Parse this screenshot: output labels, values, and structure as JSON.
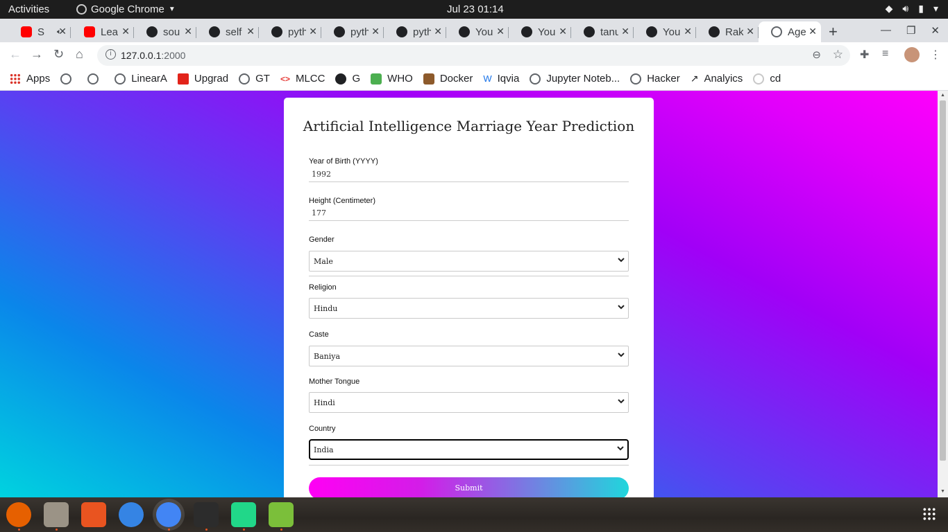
{
  "topbar": {
    "activities": "Activities",
    "app_name": "Google Chrome",
    "clock": "Jul 23  01:14",
    "tray_icons": [
      "wifi-icon",
      "volume-icon",
      "battery-icon",
      "power-menu-icon"
    ]
  },
  "tabs": [
    {
      "title": "S",
      "favicon": "youtube-icon",
      "audio": true
    },
    {
      "title": "Lear",
      "favicon": "youtube-icon"
    },
    {
      "title": "sou",
      "favicon": "github-icon"
    },
    {
      "title": "self",
      "favicon": "github-icon"
    },
    {
      "title": "pyth",
      "favicon": "github-icon"
    },
    {
      "title": "pyth",
      "favicon": "github-icon"
    },
    {
      "title": "pyth",
      "favicon": "github-icon"
    },
    {
      "title": "You",
      "favicon": "github-icon"
    },
    {
      "title": "You",
      "favicon": "github-icon"
    },
    {
      "title": "tanu",
      "favicon": "github-icon"
    },
    {
      "title": "You",
      "favicon": "github-icon"
    },
    {
      "title": "Rak",
      "favicon": "github-icon"
    },
    {
      "title": "Age",
      "favicon": "globe-icon",
      "active": true
    }
  ],
  "toolbar": {
    "url_host": "127.0.0.1",
    "url_port": ":2000"
  },
  "bookmarks": [
    {
      "label": "Apps",
      "icon": "apps-grid-icon"
    },
    {
      "label": "",
      "icon": "globe-icon"
    },
    {
      "label": "",
      "icon": "globe-icon"
    },
    {
      "label": "LinearA",
      "icon": "globe-icon"
    },
    {
      "label": "Upgrad",
      "icon": "upgrad-icon"
    },
    {
      "label": "GT",
      "icon": "globe-icon"
    },
    {
      "label": "MLCC",
      "icon": "mlcc-icon"
    },
    {
      "label": "G",
      "icon": "github-icon"
    },
    {
      "label": "WHO",
      "icon": "who-icon"
    },
    {
      "label": "Docker",
      "icon": "docker-icon"
    },
    {
      "label": "Iqvia",
      "icon": "iqvia-icon"
    },
    {
      "label": "Jupyter Noteb...",
      "icon": "globe-icon"
    },
    {
      "label": "Hacker",
      "icon": "globe-icon"
    },
    {
      "label": "Analyics",
      "icon": "analytics-icon"
    },
    {
      "label": "cd",
      "icon": "cd-icon"
    }
  ],
  "form": {
    "title": "Artificial Intelligence Marriage Year Prediction",
    "year_of_birth": {
      "label": "Year of Birth (YYYY)",
      "value": "1992"
    },
    "height": {
      "label": "Height (Centimeter)",
      "value": "177"
    },
    "gender": {
      "label": "Gender",
      "value": "Male"
    },
    "religion": {
      "label": "Religion",
      "value": "Hindu"
    },
    "caste": {
      "label": "Caste",
      "value": "Baniya"
    },
    "mother_tongue": {
      "label": "Mother Tongue",
      "value": "Hindi"
    },
    "country": {
      "label": "Country",
      "value": "India"
    },
    "submit": "Submit"
  },
  "colors": {
    "bg_gradient": [
      "#00d3df",
      "#0a86ea",
      "#5b3ff2",
      "#a100f7",
      "#ff00fb"
    ],
    "submit_gradient": [
      "#ff00f4",
      "#20d6dc"
    ],
    "ubuntu_accent": "#e95420"
  },
  "dock": [
    {
      "name": "firefox-icon",
      "running": true
    },
    {
      "name": "files-icon",
      "running": true
    },
    {
      "name": "software-center-icon",
      "running": false
    },
    {
      "name": "help-icon",
      "running": false
    },
    {
      "name": "chrome-icon",
      "running": true
    },
    {
      "name": "terminal-icon",
      "running": true
    },
    {
      "name": "pycharm-icon",
      "running": true
    },
    {
      "name": "text-editor-icon",
      "running": true
    }
  ]
}
